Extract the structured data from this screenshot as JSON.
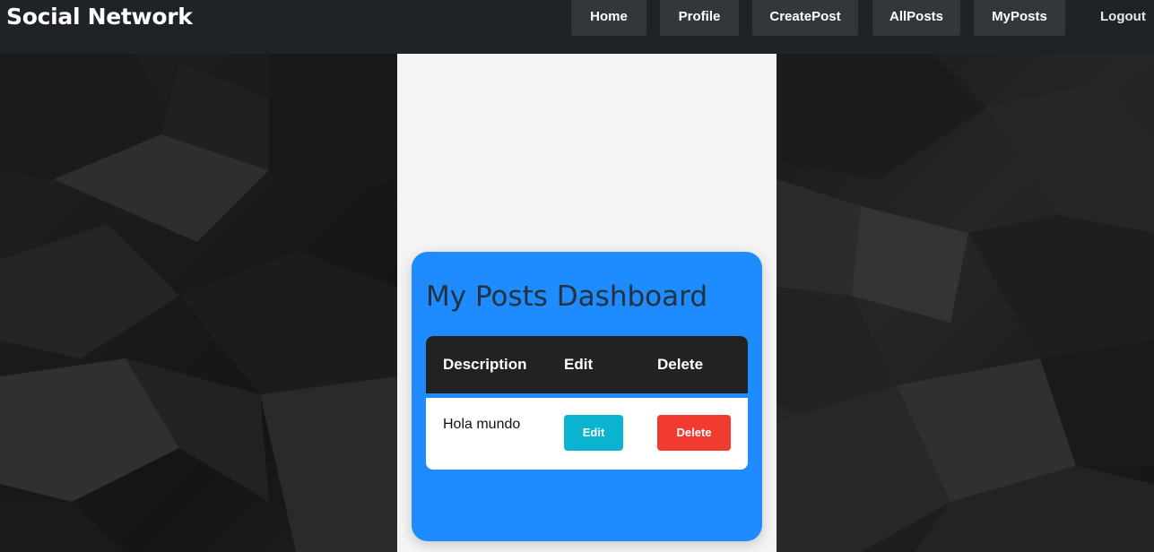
{
  "navbar": {
    "brand": "Social Network",
    "links": [
      {
        "label": "Home"
      },
      {
        "label": "Profile"
      },
      {
        "label": "CreatePost"
      },
      {
        "label": "AllPosts"
      },
      {
        "label": "MyPosts"
      }
    ],
    "logout_label": "Logout"
  },
  "dashboard": {
    "title": "My Posts Dashboard",
    "columns": [
      "Description",
      "Edit",
      "Delete"
    ],
    "rows": [
      {
        "description": "Hola mundo",
        "edit_label": "Edit",
        "delete_label": "Delete"
      }
    ]
  },
  "colors": {
    "navbar_bg": "#1f2327",
    "nav_button_bg": "#34373a",
    "card_accent": "#1e8cff",
    "table_header_bg": "#222222",
    "edit_button": "#0ab3cf",
    "delete_button": "#f13b31",
    "column_bg": "#f4f4f4"
  }
}
